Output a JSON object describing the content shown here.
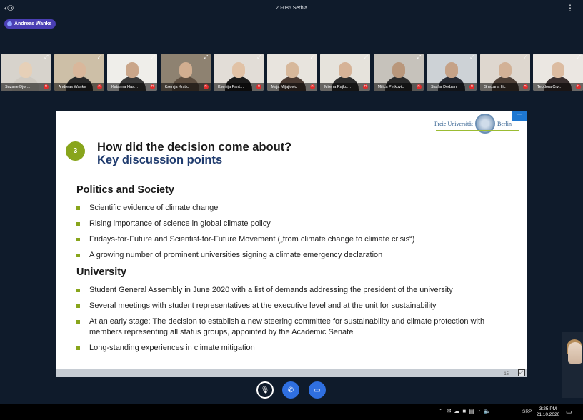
{
  "window": {
    "title": "20-086 Serbia",
    "back_label": "‹",
    "more_label": "⋮"
  },
  "active_speaker": {
    "name": "Andreas Wanke"
  },
  "participants": [
    {
      "name": "Suzane Djor…",
      "bg": "#d7d3cc",
      "skin": "#e6d0b8",
      "cloth": "#cfcac2"
    },
    {
      "name": "Andreas Wanke",
      "bg": "#cdbfa7",
      "skin": "#d9b79b",
      "cloth": "#2a2a2a"
    },
    {
      "name": "Katarina Has…",
      "bg": "#efeeea",
      "skin": "#caa68a",
      "cloth": "#3a3a3a"
    },
    {
      "name": "Ksenija Krstic",
      "bg": "#8e8271",
      "skin": "#d1ae90",
      "cloth": "#5d4e40"
    },
    {
      "name": "Ksenija Pant…",
      "bg": "#e2ddd7",
      "skin": "#e1c2a6",
      "cloth": "#1c1c1c"
    },
    {
      "name": "Maja Mijajlovic",
      "bg": "#e8e4de",
      "skin": "#d7b89b",
      "cloth": "#4b3b33"
    },
    {
      "name": "Milena Rajko…",
      "bg": "#e6e3dc",
      "skin": "#d6b397",
      "cloth": "#2d2d2d"
    },
    {
      "name": "Milica Petkovic",
      "bg": "#c6c2bb",
      "skin": "#b9977b",
      "cloth": "#2b2b2b"
    },
    {
      "name": "Sasha Dedzan",
      "bg": "#cdd2d6",
      "skin": "#c5a287",
      "cloth": "#272b34"
    },
    {
      "name": "Snezana Ilic",
      "bg": "#ded7cf",
      "skin": "#d2b196",
      "cloth": "#4d3f36"
    },
    {
      "name": "Teodora Crv…",
      "bg": "#ebe7e2",
      "skin": "#dcbca1",
      "cloth": "#3a3030"
    }
  ],
  "slide": {
    "logo_left": "Freie Universität",
    "logo_right": "Berlin",
    "number": "3",
    "title_line1": "How did the decision come about?",
    "title_line2": "Key discussion points",
    "section1": {
      "heading": "Politics and Society",
      "bullets": [
        "Scientific evidence of climate change",
        "Rising importance of science in global climate policy",
        "Fridays-for-Future and Scientist-for-Future Movement („from climate change to climate crisis“)",
        "A growing number of prominent universities signing a climate emergency declaration"
      ]
    },
    "section2": {
      "heading": "University",
      "bullets": [
        "Student General Assembly in June 2020 with a list of demands addressing the president of the university",
        "Several meetings with student representatives at the executive level and at the unit for sustainability",
        "At an early stage: The decision to establish a new steering committee for sustainability and climate protection with members representing all status groups, appointed by the Academic Senate",
        "Long-standing experiences in climate mitigation"
      ]
    },
    "page_number": "15",
    "accent_color": "#88a51c",
    "title_color": "#1f3b6e"
  },
  "controls": {
    "mic_icon": "mic-muted-icon",
    "call_icon": "phone-icon",
    "camera_icon": "camera-icon"
  },
  "taskbar": {
    "language": "SRP",
    "time": "3:25 PM",
    "date": "21.10.2020",
    "notifications": "4"
  }
}
